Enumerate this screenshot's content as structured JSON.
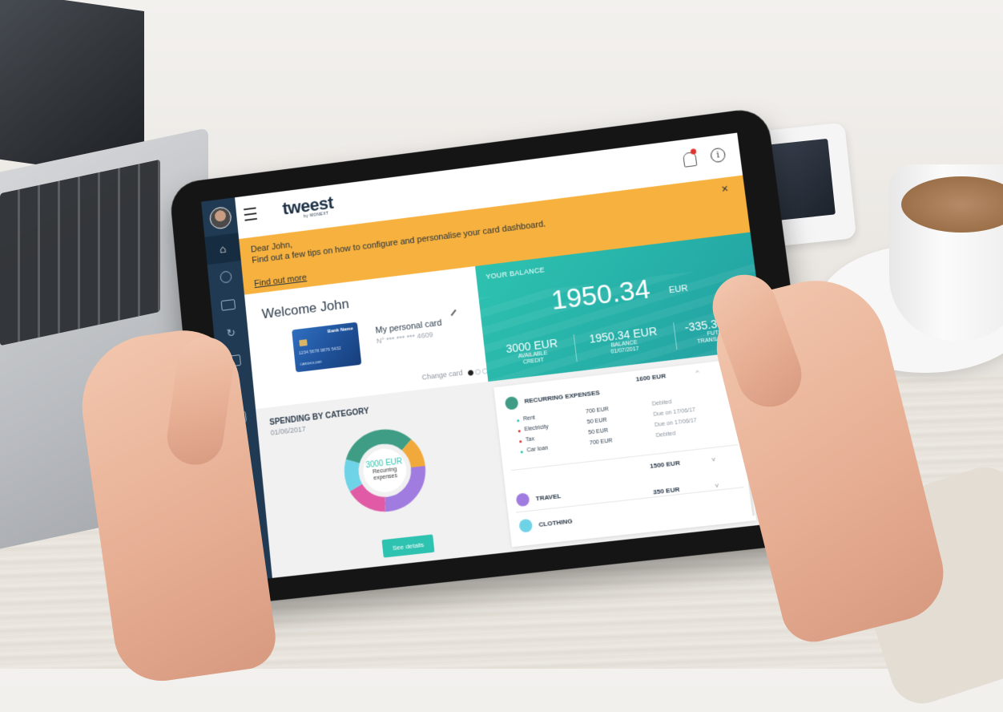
{
  "colors": {
    "accent_teal": "#2ec2b0",
    "banner_orange": "#f7b13e",
    "sidebar_navy": "#1f3a52"
  },
  "topbar": {
    "brand": "tweest",
    "brand_sub": "by MONEXT",
    "info_glyph": "i"
  },
  "banner": {
    "line1": "Dear John,",
    "line2": "Find out a few tips on how to configure and personalise your card dashboard.",
    "link": "Find out more",
    "close": "×"
  },
  "sidebar": {
    "items": [
      "home-icon",
      "pie-chart-icon",
      "card-icon",
      "refresh-icon",
      "wallet-icon",
      "users-icon",
      "chat-icon",
      "phone-icon",
      "settings-icon"
    ]
  },
  "welcome": {
    "title": "Welcome John",
    "bank_name": "Bank Name",
    "card_number_on_card": "1234 5678 9876 5432",
    "card_holder": "CARDHOLDER",
    "card_title": "My personal card",
    "card_number": "N° *** *** *** 4609",
    "change_card": "Change card"
  },
  "balance": {
    "label": "YOUR BALANCE",
    "amount": "1950.34",
    "currency": "EUR",
    "stats": [
      {
        "value": "3000 EUR",
        "label_1": "AVAILABLE",
        "label_2": "CREDIT"
      },
      {
        "value": "1950.34 EUR",
        "label_1": "BALANCE",
        "label_2": "01/07/2017"
      },
      {
        "value": "-335.30 EUR",
        "label_1": "FUTURE",
        "label_2": "TRANSACTIONS"
      }
    ],
    "more": "..."
  },
  "spending": {
    "title": "SPENDING BY CATEGORY",
    "date": "01/06/2017",
    "donut_value": "3000 EUR",
    "donut_label_1": "Recurring",
    "donut_label_2": "expenses",
    "button": "See details"
  },
  "categories": {
    "recurring": {
      "title": "RECURRING EXPENSES",
      "amount": "1600 EUR",
      "items": [
        {
          "name": "Rent",
          "amount": "700 EUR",
          "status": "Debited",
          "bullet": "#2ec2b0"
        },
        {
          "name": "Electricity",
          "amount": "50 EUR",
          "status": "Due on 17/06/17",
          "bullet": "#e2322d"
        },
        {
          "name": "Tax",
          "amount": "50 EUR",
          "status": "Due on 17/06/17",
          "bullet": "#e2322d"
        },
        {
          "name": "Car loan",
          "amount": "700 EUR",
          "status": "Debited",
          "bullet": "#2ec2b0"
        }
      ]
    },
    "travel": {
      "title": "TRAVEL",
      "amount": "1500 EUR"
    },
    "clothing": {
      "title": "CLOTHING",
      "amount": "350 EUR"
    }
  }
}
